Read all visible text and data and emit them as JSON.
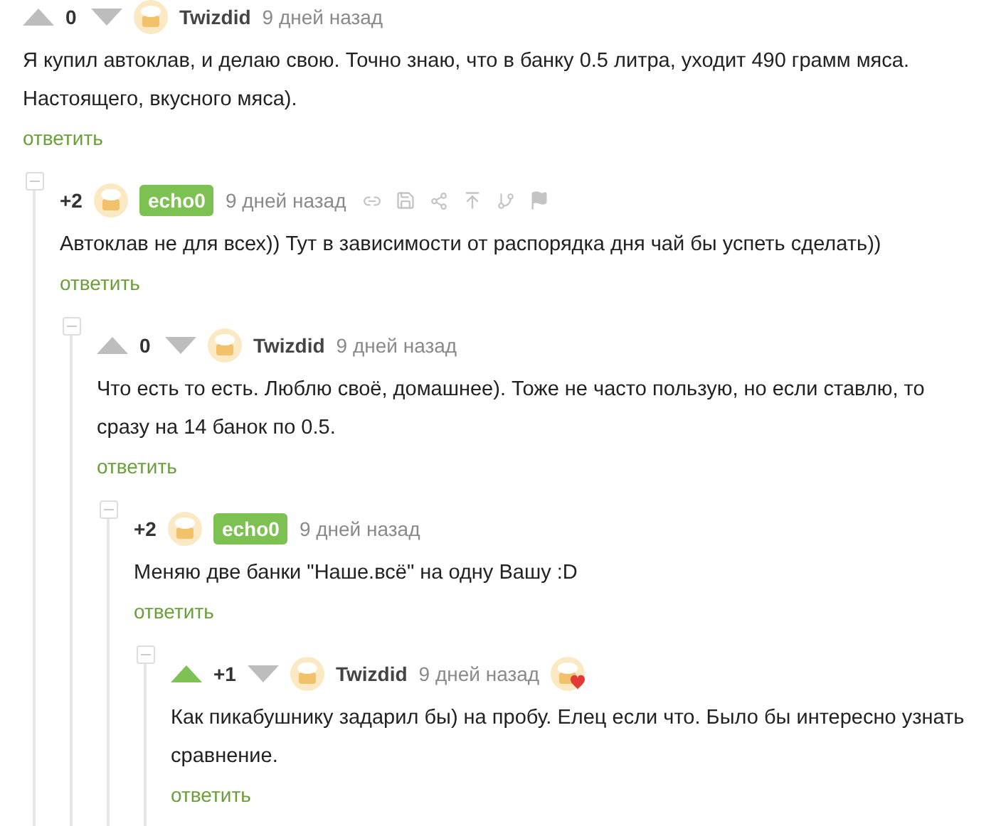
{
  "comments": [
    {
      "voted_up": false,
      "score": "0",
      "author": "Twizdid",
      "time": "9 дней назад",
      "text": "Я купил автоклав, и делаю свою. Точно знаю, что в банку 0.5 литра, уходит 490 грамм мяса. Настоящего, вкусного мяса).",
      "reply": "ответить",
      "children": [
        {
          "score": "+2",
          "author": "echo0",
          "badge": true,
          "time": "9 дней назад",
          "actions": true,
          "text": "Автоклав не для всех)) Тут в зависимости от распорядка дня чай бы успеть сделать))",
          "reply": "ответить",
          "children": [
            {
              "voted_up": false,
              "score": "0",
              "author": "Twizdid",
              "time": "9 дней назад",
              "text": "Что есть то есть. Люблю своё, домашнее). Тоже не часто пользую, но если ставлю, то сразу на 14 банок по 0.5.",
              "reply": "ответить",
              "children": [
                {
                  "score": "+2",
                  "author": "echo0",
                  "badge": true,
                  "time": "9 дней назад",
                  "text": "Меняю две банки \"Наше.всё\" на одну Вашу :D",
                  "reply": "ответить",
                  "children": [
                    {
                      "voted_up": true,
                      "score": "+1",
                      "author": "Twizdid",
                      "time": "9 дней назад",
                      "reaction": true,
                      "text": "Как пикабушнику задарил бы) на пробу. Елец если что. Было бы интересно узнать сравнение.",
                      "reply": "ответить"
                    }
                  ]
                }
              ]
            }
          ]
        }
      ]
    }
  ]
}
